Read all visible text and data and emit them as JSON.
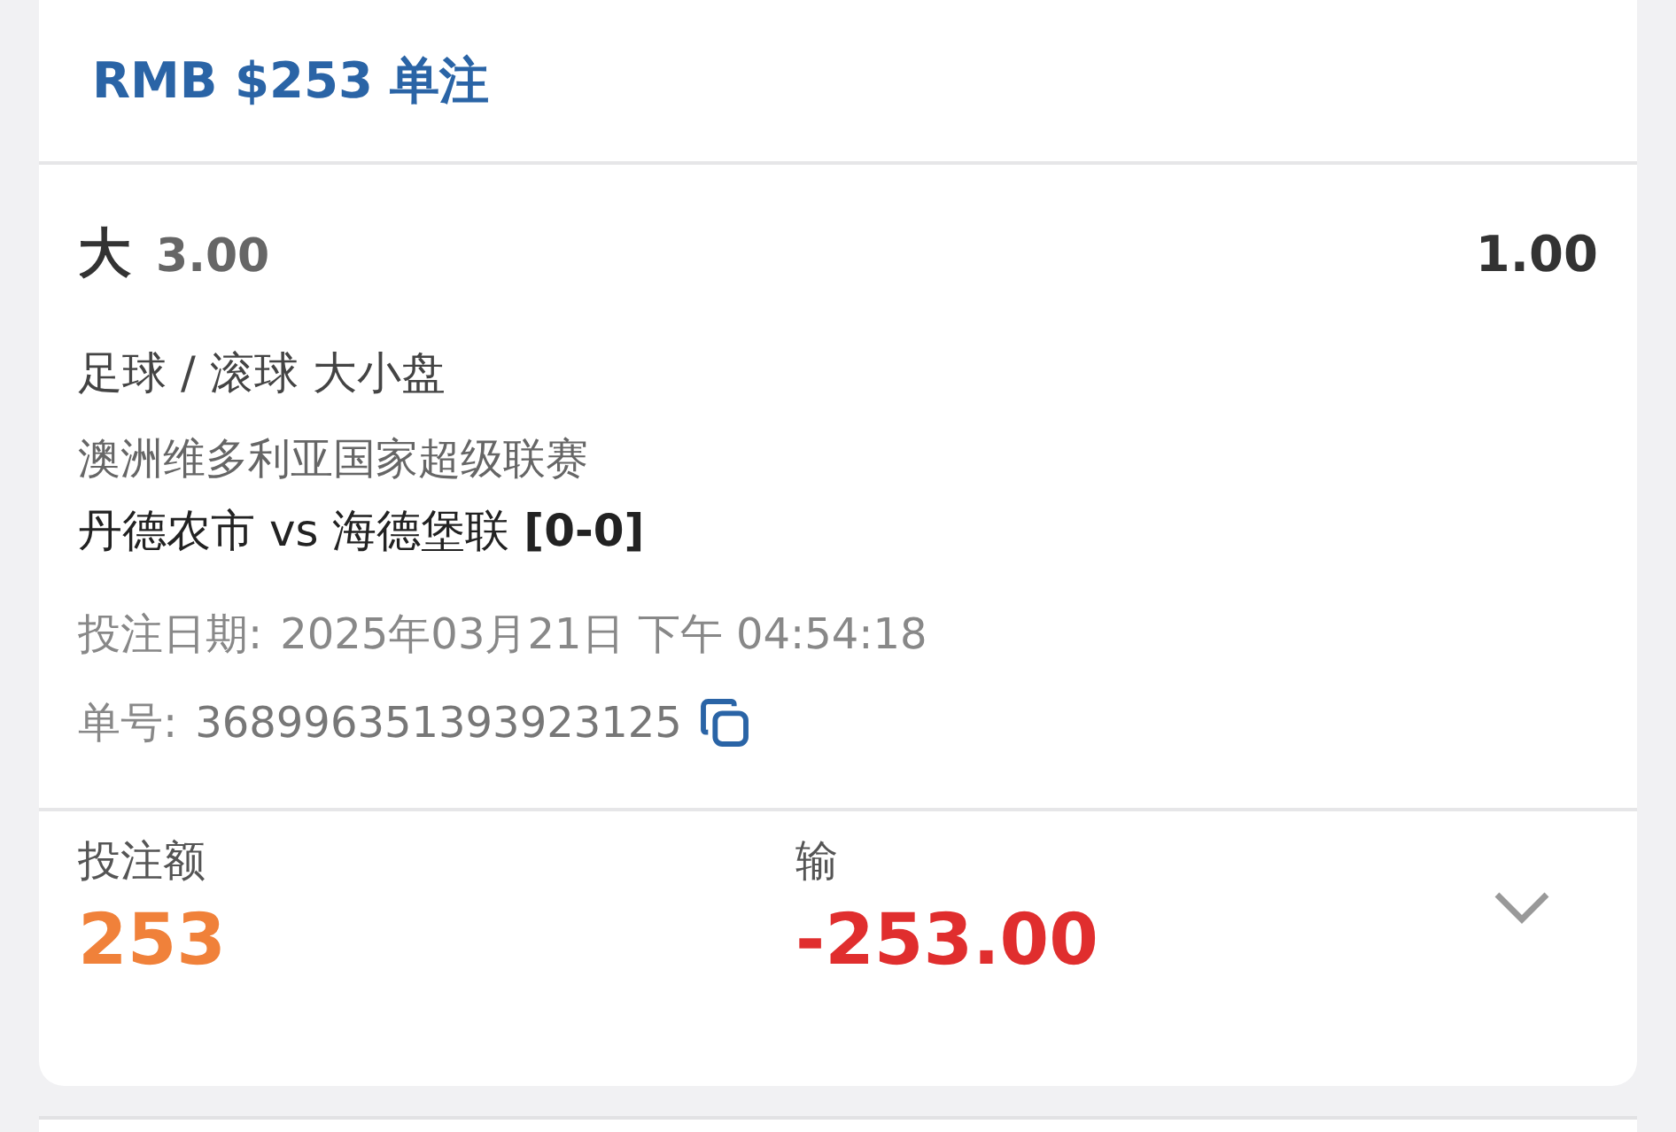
{
  "header": {
    "title": "RMB $253 单注"
  },
  "bet": {
    "selection": "大",
    "line": "3.00",
    "odds": "1.00",
    "market": "足球 / 滚球 大小盘",
    "league": "澳洲维多利亚国家超级联赛",
    "match": "丹德农市 vs 海德堡联 **[0-0]**",
    "date_label": "投注日期:",
    "date": "2025年03月21日 下午 04:54:18",
    "ticket_label": "单号:",
    "ticket": "368996351393923125"
  },
  "summary": {
    "stake_label": "投注额",
    "stake": "253",
    "result_label": "输",
    "result": "-253.00",
    "expanded": false
  }
}
